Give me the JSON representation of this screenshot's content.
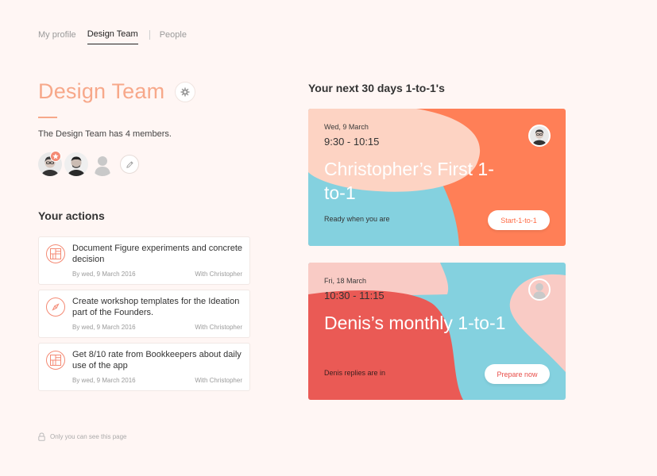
{
  "nav": {
    "tabs": [
      {
        "label": "My profile"
      },
      {
        "label": "Design Team"
      },
      {
        "label": "People"
      }
    ]
  },
  "team": {
    "title": "Design Team",
    "members_text": "The Design Team has 4 members."
  },
  "actions": {
    "heading": "Your actions",
    "items": [
      {
        "text": "Document Figure experiments and concrete decision",
        "date": "By wed, 9 March 2016",
        "with": "With Christopher",
        "icon": "grid-icon"
      },
      {
        "text": "Create workshop templates for the Ideation part of the Founders.",
        "date": "By wed, 9 March 2016",
        "with": "With Christopher",
        "icon": "compass-icon"
      },
      {
        "text": "Get 8/10 rate from Bookkeepers about daily use of the app",
        "date": "By wed, 9 March 2016",
        "with": "With Christopher",
        "icon": "grid-icon"
      }
    ]
  },
  "privacy": {
    "text": "Only you can see this page"
  },
  "upcoming": {
    "heading": "Your next 30 days 1-to-1's",
    "cards": [
      {
        "date": "Wed, 9 March",
        "time": "9:30 - 10:15",
        "title": "Christopher’s First 1-to-1",
        "status": "Ready when you are",
        "cta": "Start-1-to-1"
      },
      {
        "date": "Fri, 18 March",
        "time": "10:30 - 11:15",
        "title": "Denis’s monthly 1-to-1",
        "status": "Denis replies are in",
        "cta": "Prepare now"
      }
    ]
  },
  "colors": {
    "accent": "#f7a88a",
    "coral": "#f48a74",
    "orange": "#ff7f57",
    "sky": "#84d1df",
    "peach": "#fdd3c3",
    "red": "#ea5a55",
    "pink": "#f9cbc5"
  }
}
